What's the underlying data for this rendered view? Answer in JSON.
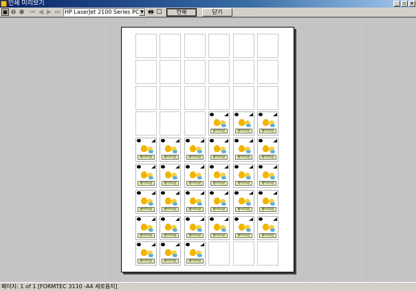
{
  "window": {
    "title": "인쇄 미리보기"
  },
  "toolbar": {
    "printer": "HP LaserJet 2100 Series PCL 6",
    "print_label": "인쇄",
    "close_label": "닫기"
  },
  "label": {
    "tag_text": "병아리반"
  },
  "sheet": {
    "columns": 6,
    "rows": 9,
    "filled_cells": [
      21,
      22,
      23,
      24,
      25,
      26,
      27,
      28,
      29,
      30,
      31,
      32,
      33,
      34,
      35,
      36,
      37,
      38,
      39,
      40,
      41,
      42,
      43,
      44,
      45,
      46,
      47,
      48,
      49,
      50
    ]
  },
  "status": {
    "text": "페이지: 1 of 1 [FORMTEC 3110 -A4 세로용지]"
  },
  "colors": {
    "title_active": "#0a246a",
    "label_tag": "#e8f2b0",
    "chick": "#f2b400"
  }
}
